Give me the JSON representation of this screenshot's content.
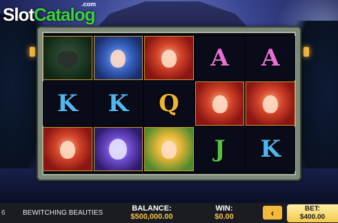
{
  "brand": {
    "logo_slot": "Slot",
    "logo_catalog": "Catalog",
    "logo_com": ".com"
  },
  "reels": [
    [
      {
        "symbol": "wolf",
        "kind": "character",
        "name": "wolf-symbol"
      },
      {
        "symbol": "K",
        "kind": "letter"
      },
      {
        "symbol": "redhead",
        "kind": "character",
        "name": "red-haired-beauty-symbol"
      }
    ],
    [
      {
        "symbol": "witch",
        "kind": "character",
        "name": "blue-witch-symbol"
      },
      {
        "symbol": "K",
        "kind": "letter"
      },
      {
        "symbol": "owl",
        "kind": "character",
        "name": "owl-symbol"
      }
    ],
    [
      {
        "symbol": "redhead",
        "kind": "character",
        "name": "red-haired-beauty-symbol"
      },
      {
        "symbol": "Q",
        "kind": "letter"
      },
      {
        "symbol": "fairy",
        "kind": "character",
        "name": "blonde-fairy-symbol"
      }
    ],
    [
      {
        "symbol": "A",
        "kind": "letter"
      },
      {
        "symbol": "redhead",
        "kind": "character",
        "name": "red-haired-beauty-symbol"
      },
      {
        "symbol": "J",
        "kind": "letter"
      }
    ],
    [
      {
        "symbol": "A",
        "kind": "letter"
      },
      {
        "symbol": "redhead",
        "kind": "character",
        "name": "red-haired-beauty-symbol"
      },
      {
        "symbol": "K",
        "kind": "letter"
      }
    ]
  ],
  "bottom_bar": {
    "left_number": "6",
    "game_title": "BEWITCHING BEAUTIES",
    "balance_label": "BALANCE:",
    "balance_value": "$500,000.00",
    "win_label": "WIN:",
    "win_value": "$0.00",
    "arrow_icon": "chevron-left-icon",
    "arrow_glyph": "‹",
    "bet_label": "BET:",
    "bet_value": "$400.00"
  },
  "colors": {
    "letter_A": "#e86fd8",
    "letter_K": "#4fb6f0",
    "letter_Q": "#f1b52c",
    "letter_J": "#56c23d",
    "value_text": "#f6c343",
    "bet_button": "#f2c84a"
  }
}
